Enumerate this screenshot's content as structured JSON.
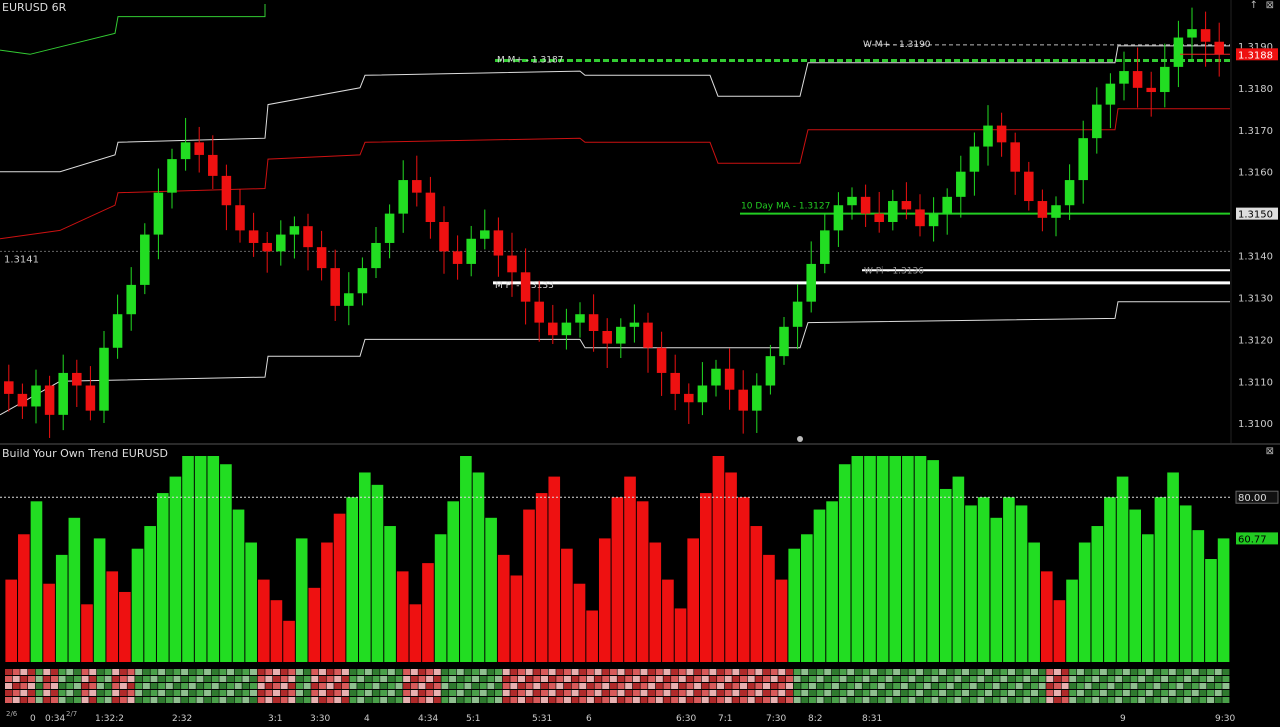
{
  "window": {
    "symbol_title": "EURUSD 6R",
    "indicator_title": "Build Your Own Trend EURUSD",
    "controls": {
      "up_arrow": "↑",
      "close": "⊠",
      "indicator_close": "⊠"
    }
  },
  "colors": {
    "up": "#22dd22",
    "down": "#ee1111",
    "background": "#000000",
    "pivot_white": "#ffffff",
    "pivot_red": "#cc1111",
    "pivot_green": "#33cc33"
  },
  "chart_data": [
    {
      "type": "candlestick",
      "title": "EURUSD 6R",
      "ylim": [
        1.3096,
        1.32
      ],
      "y_ticks": [
        "1.3190",
        "1.3180",
        "1.3170",
        "1.3160",
        "1.3150",
        "1.3140",
        "1.3130",
        "1.3120",
        "1.3110",
        "1.3100"
      ],
      "price_labels": {
        "last_price": "1.3188",
        "ma_price": "1.3150",
        "left_dotted": "1.3141"
      },
      "annotations": [
        {
          "text": "M M+ - 1.3187",
          "price": 1.3187
        },
        {
          "text": "W M+ - 1.3190",
          "price": 1.319
        },
        {
          "text": "10 Day MA - 1.3127",
          "price": 1.315
        },
        {
          "text": "M Pi - 1.3133",
          "price": 1.3133
        },
        {
          "text": "W Pi - 1.3136",
          "price": 1.3136
        }
      ],
      "close_path": [
        1.3107,
        1.3104,
        1.3109,
        1.3102,
        1.3112,
        1.3109,
        1.3103,
        1.3118,
        1.3126,
        1.3133,
        1.3145,
        1.3155,
        1.3163,
        1.3167,
        1.3164,
        1.3159,
        1.3152,
        1.3146,
        1.3143,
        1.3141,
        1.3145,
        1.3147,
        1.3142,
        1.3137,
        1.3128,
        1.3131,
        1.3137,
        1.3143,
        1.315,
        1.3158,
        1.3155,
        1.3148,
        1.3141,
        1.3138,
        1.3144,
        1.3146,
        1.314,
        1.3136,
        1.3129,
        1.3124,
        1.3121,
        1.3124,
        1.3126,
        1.3122,
        1.3119,
        1.3123,
        1.3124,
        1.3118,
        1.3112,
        1.3107,
        1.3105,
        1.3109,
        1.3113,
        1.3108,
        1.3103,
        1.3109,
        1.3116,
        1.3123,
        1.3129,
        1.3138,
        1.3146,
        1.3152,
        1.3154,
        1.315,
        1.3148,
        1.3153,
        1.3151,
        1.3147,
        1.315,
        1.3154,
        1.316,
        1.3166,
        1.3171,
        1.3167,
        1.316,
        1.3153,
        1.3149,
        1.3152,
        1.3158,
        1.3168,
        1.3176,
        1.3181,
        1.3184,
        1.318,
        1.3179,
        1.3185,
        1.3192,
        1.3194,
        1.3191,
        1.3188
      ]
    },
    {
      "type": "bar",
      "title": "Build Your Own Trend EURUSD",
      "ylim": [
        0,
        100
      ],
      "y_ticks": [
        "80.00"
      ],
      "last_value_label": "60.77",
      "reference_line": 80,
      "values": [
        40,
        62,
        78,
        38,
        52,
        70,
        28,
        60,
        44,
        34,
        55,
        66,
        82,
        90,
        100,
        100,
        100,
        96,
        74,
        58,
        40,
        30,
        20,
        60,
        36,
        58,
        72,
        80,
        92,
        86,
        66,
        44,
        28,
        48,
        62,
        78,
        100,
        92,
        70,
        52,
        42,
        74,
        82,
        90,
        55,
        38,
        25,
        60,
        80,
        90,
        78,
        58,
        40,
        26,
        60,
        82,
        100,
        92,
        80,
        66,
        52,
        40,
        55,
        62,
        74,
        78,
        96,
        100,
        100,
        100,
        100,
        100,
        100,
        98,
        84,
        90,
        76,
        80,
        70,
        80,
        76,
        58,
        44,
        30,
        40,
        58,
        66,
        80,
        90,
        74,
        62,
        80,
        92,
        76,
        64,
        50,
        60
      ],
      "signs": [
        -1,
        -1,
        1,
        -1,
        1,
        1,
        -1,
        1,
        -1,
        -1,
        1,
        1,
        1,
        1,
        1,
        1,
        1,
        1,
        1,
        1,
        -1,
        -1,
        -1,
        1,
        -1,
        -1,
        -1,
        1,
        1,
        1,
        1,
        -1,
        -1,
        -1,
        1,
        1,
        1,
        1,
        1,
        -1,
        -1,
        -1,
        -1,
        -1,
        -1,
        -1,
        -1,
        -1,
        -1,
        -1,
        -1,
        -1,
        -1,
        -1,
        -1,
        -1,
        -1,
        -1,
        -1,
        -1,
        -1,
        -1,
        1,
        1,
        1,
        1,
        1,
        1,
        1,
        1,
        1,
        1,
        1,
        1,
        1,
        1,
        1,
        1,
        1,
        1,
        1,
        1,
        -1,
        -1,
        1,
        1,
        1,
        1,
        1,
        1,
        1,
        1,
        1,
        1,
        1,
        1,
        1
      ]
    }
  ],
  "time_axis": [
    "0",
    "0:34",
    "1:32:2",
    "2:32",
    "3:1",
    "3:30",
    "4",
    "4:34",
    "5:1",
    "5:31",
    "6",
    "6:30",
    "7:1",
    "7:30",
    "8:2",
    "8:31",
    "9",
    "9:30"
  ],
  "date_labels": [
    "2/6",
    "2/7"
  ]
}
